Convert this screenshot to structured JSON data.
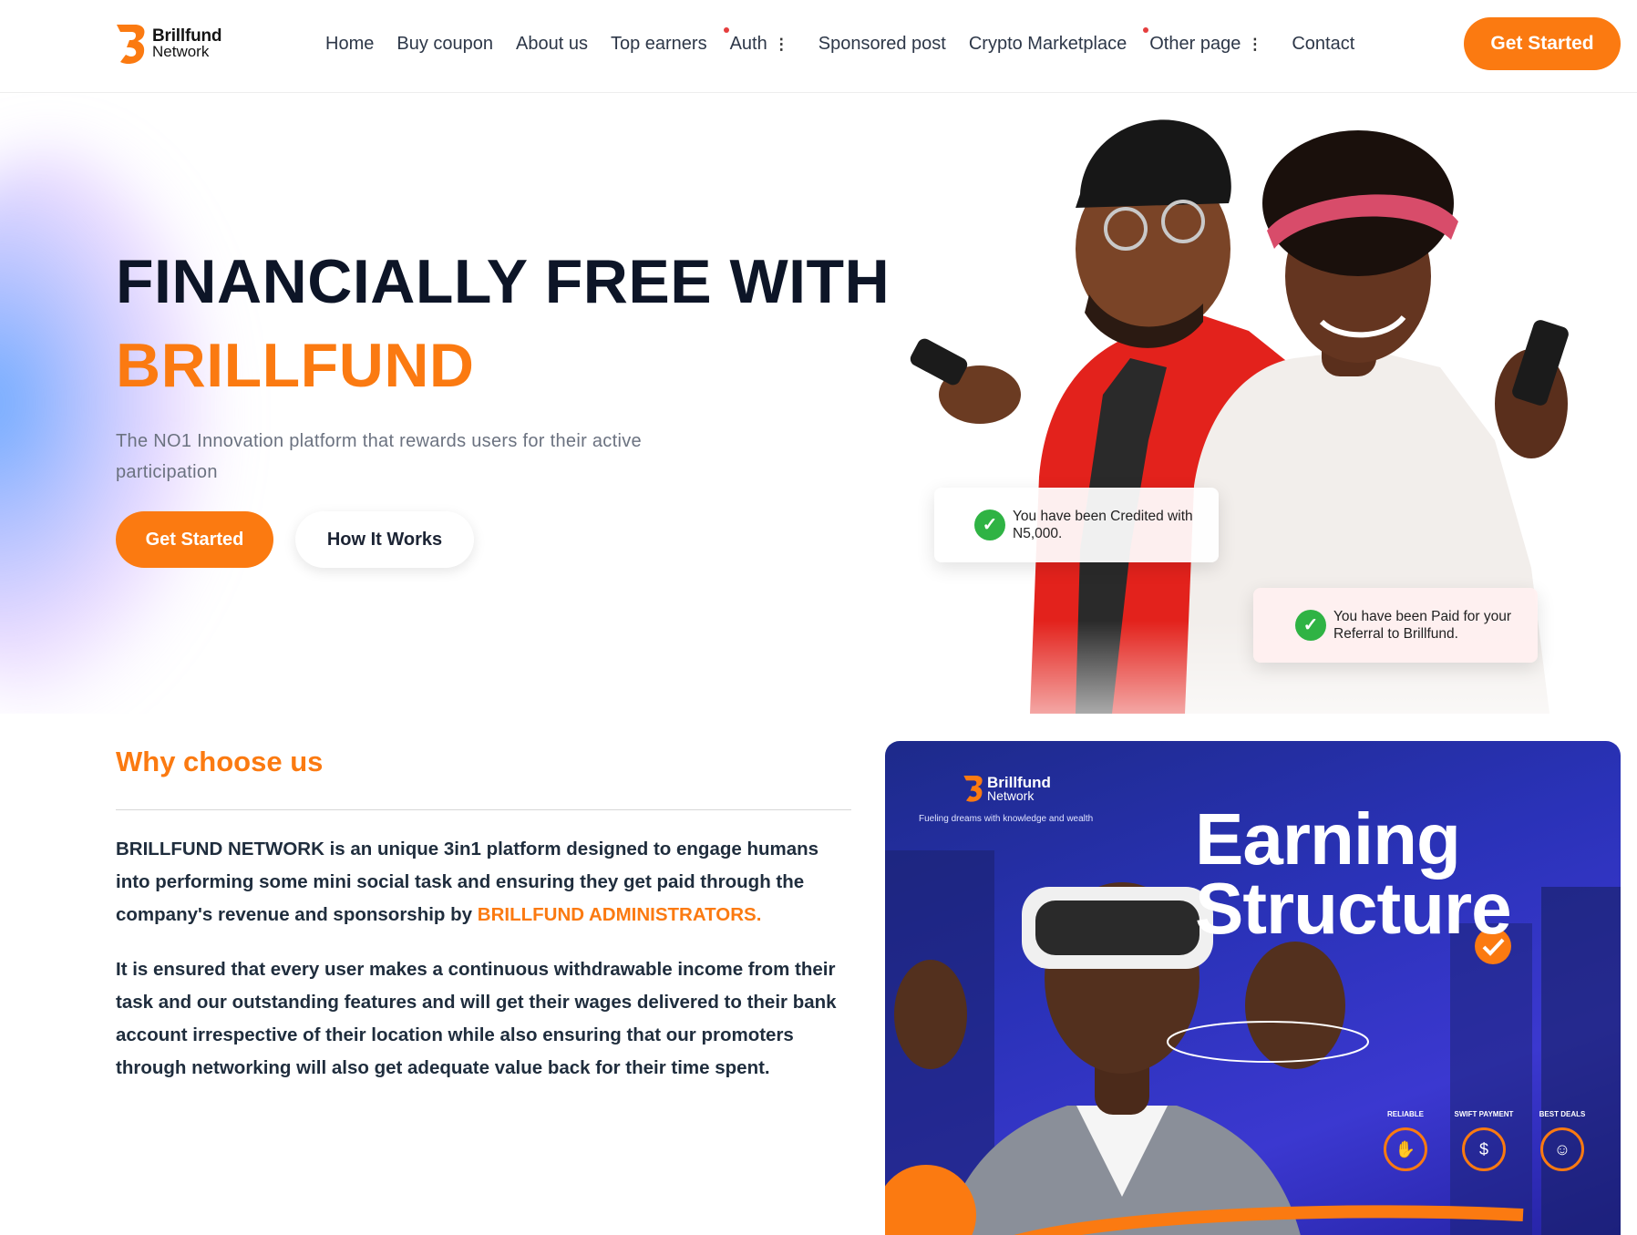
{
  "brand": {
    "name_line1": "Brillfund",
    "name_line2": "Network"
  },
  "nav": {
    "items": [
      {
        "label": "Home"
      },
      {
        "label": "Buy coupon"
      },
      {
        "label": "About us"
      },
      {
        "label": "Top earners"
      },
      {
        "label": "Auth"
      },
      {
        "label": "Sponsored post"
      },
      {
        "label": "Crypto Marketplace"
      },
      {
        "label": "Other page"
      },
      {
        "label": "Contact"
      }
    ],
    "cta": "Get Started"
  },
  "hero": {
    "title_line1": "FINANCIALLY FREE WITH",
    "title_line2": "BRILLFUND",
    "subtitle": "The NO1 Innovation platform that rewards users for their active participation",
    "primary_cta": "Get Started",
    "secondary_cta": "How It Works",
    "toast1": "You have been Credited with N5,000.",
    "toast2": "You have been Paid for your Referral to Brillfund."
  },
  "why": {
    "title": "Why choose us",
    "p1_part1": "BRILLFUND NETWORK is an unique 3in1 platform designed to engage humans into performing some mini social task and ensuring they get paid through the company's revenue and sponsorship by ",
    "p1_highlight": "BRILLFUND ADMINISTRATORS.",
    "p2": "It is ensured that every user makes a continuous withdrawable income from their task and our outstanding features and will get their wages delivered to their bank account irrespective of their location while also ensuring that our promoters through networking will also get adequate value back for their time spent."
  },
  "poster": {
    "logo_line1": "Brillfund",
    "logo_line2": "Network",
    "tagline": "Fueling dreams with knowledge and wealth",
    "title_line1": "Earning",
    "title_line2": "Structure",
    "badges": [
      "RELIABLE",
      "SWIFT PAYMENT",
      "BEST DEALS"
    ]
  },
  "colors": {
    "accent": "#fb7a11",
    "heading": "#0d1527",
    "success": "#2fb344"
  }
}
